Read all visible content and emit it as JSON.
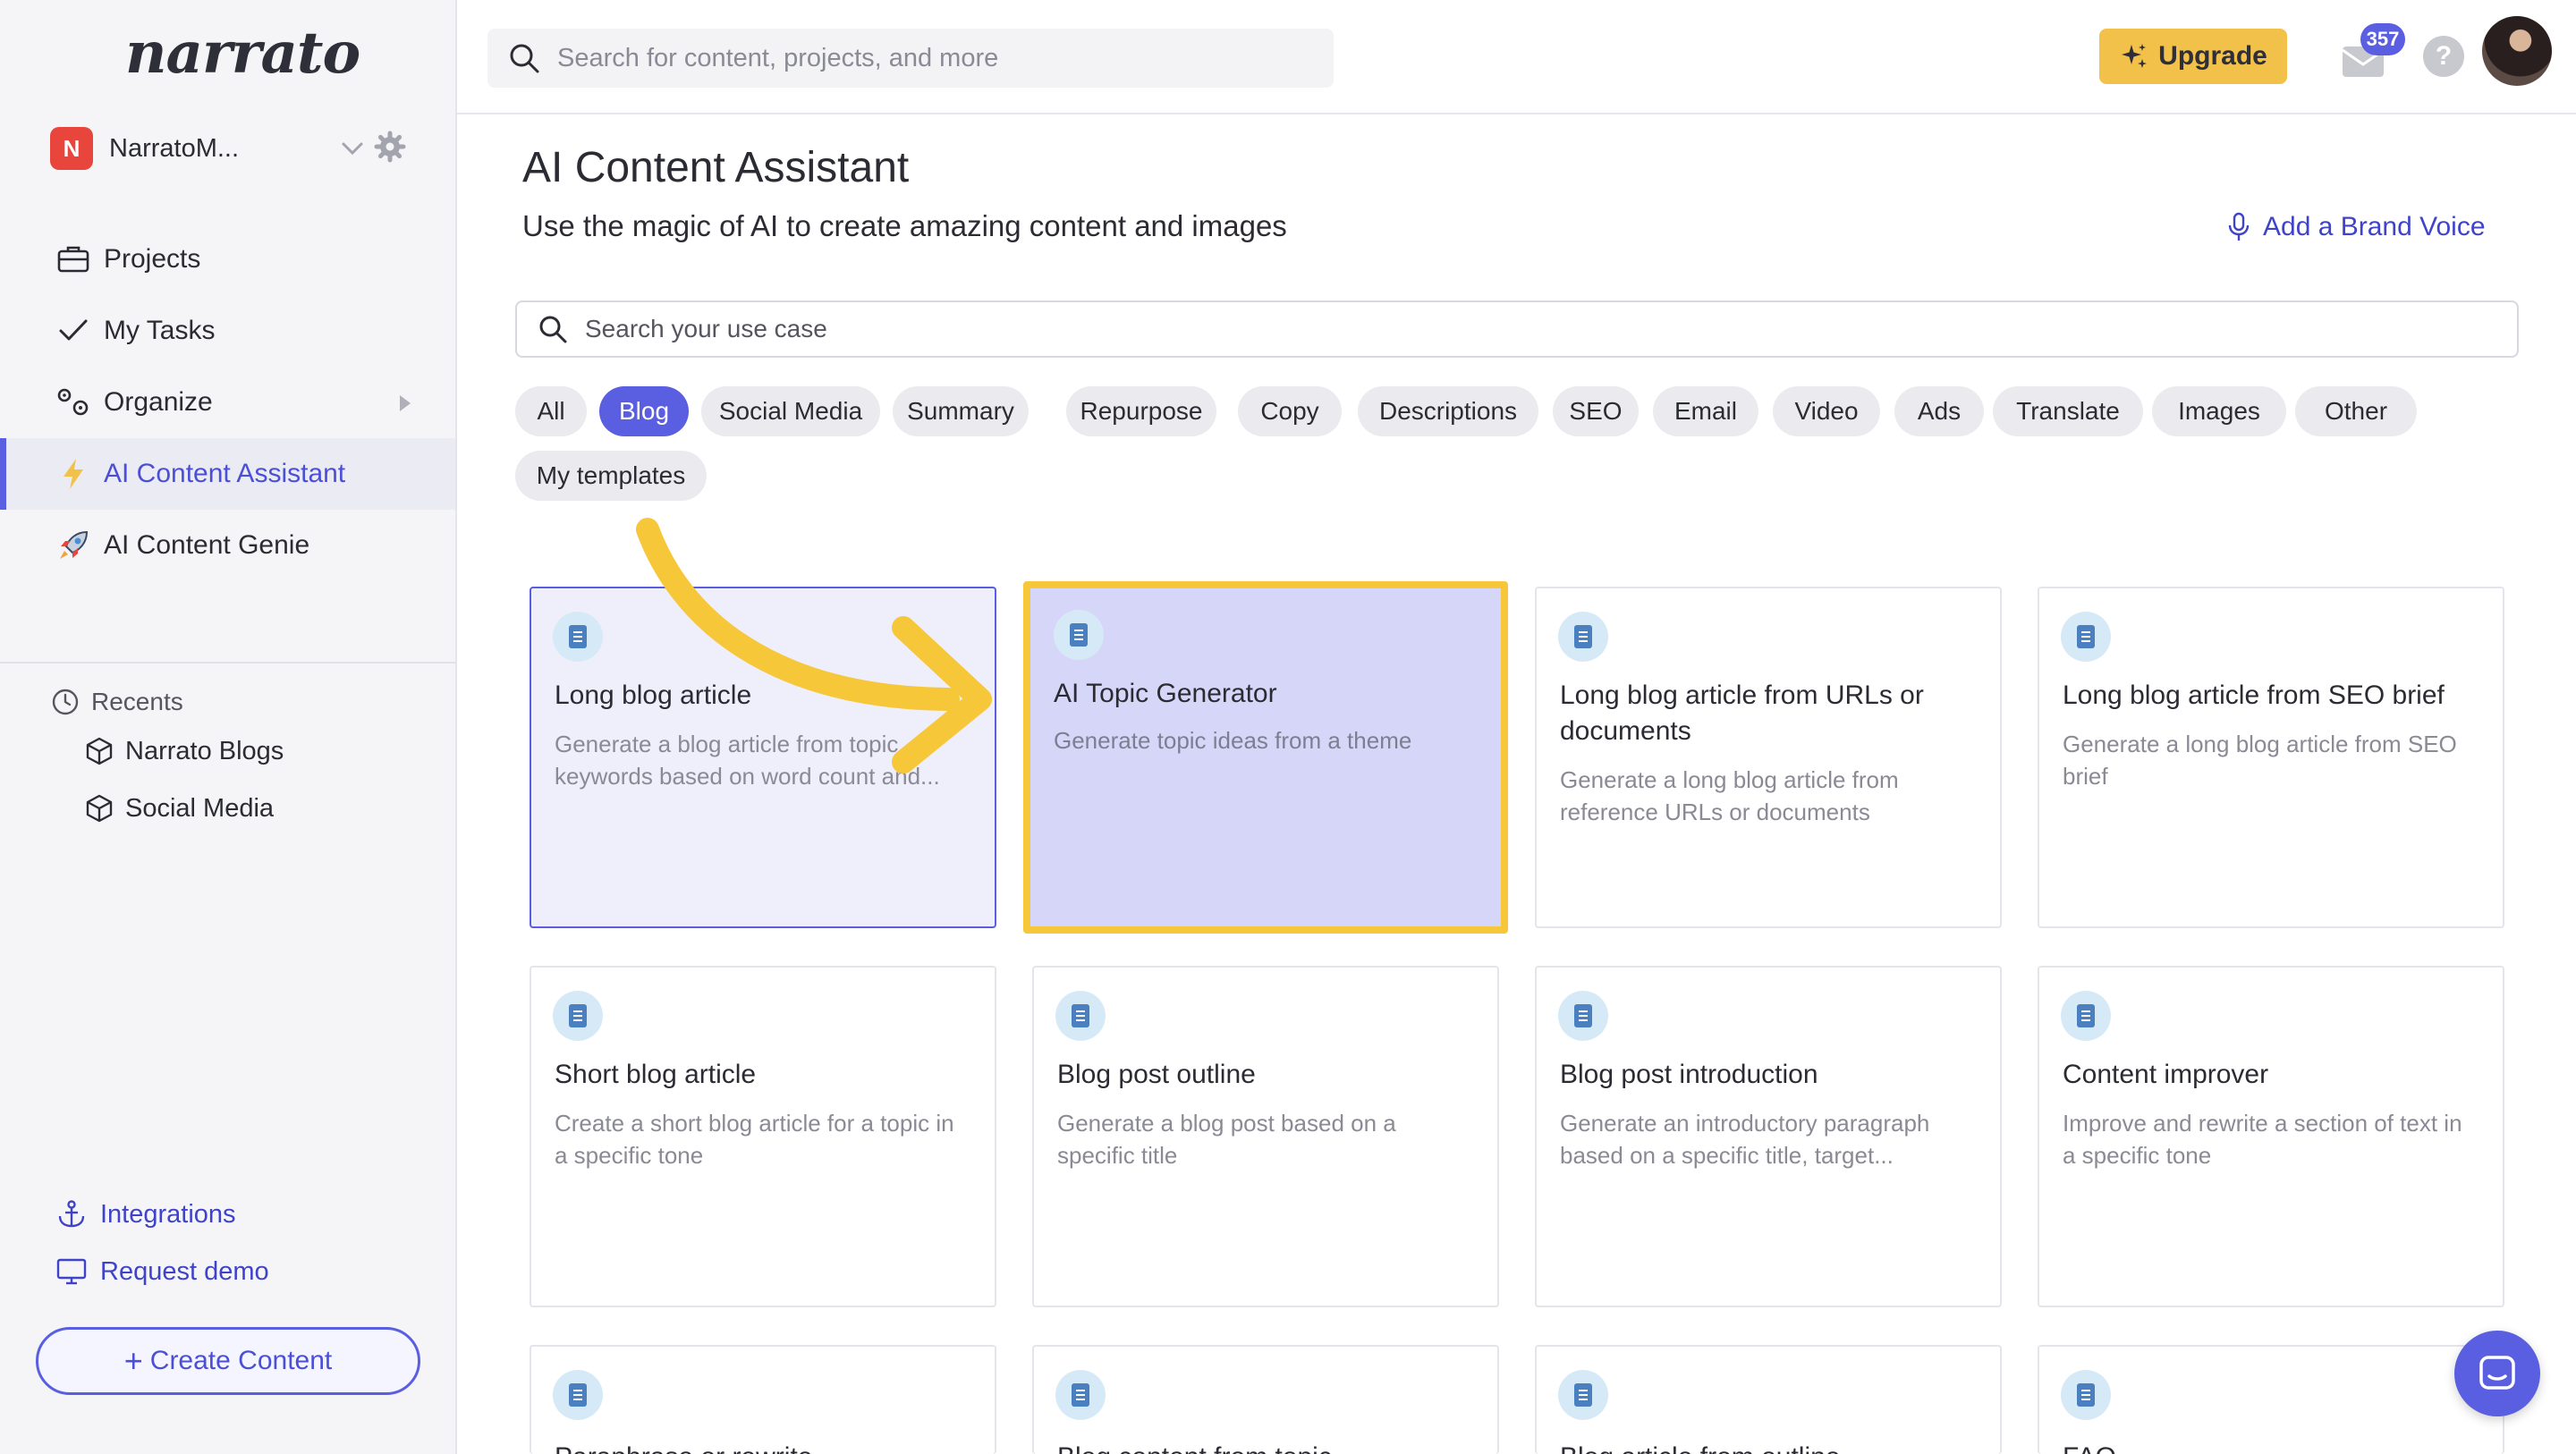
{
  "app": {
    "logo_text": "narrato"
  },
  "workspace": {
    "initial": "N",
    "name": "NarratoM..."
  },
  "sidebar": {
    "items": [
      {
        "label": "Projects",
        "icon": "briefcase-icon"
      },
      {
        "label": "My Tasks",
        "icon": "checkmark-icon"
      },
      {
        "label": "Organize",
        "icon": "organize-icon"
      },
      {
        "label": "AI Content Assistant",
        "icon": "lightning-icon",
        "active": true
      },
      {
        "label": "AI Content Genie",
        "icon": "rocket-icon"
      }
    ],
    "recents_title": "Recents",
    "recents": [
      {
        "label": "Narrato Blogs",
        "icon": "cube-icon"
      },
      {
        "label": "Social Media",
        "icon": "cube-icon"
      }
    ],
    "integrations_label": "Integrations",
    "request_demo_label": "Request demo",
    "create_content_label": "Create Content"
  },
  "topbar": {
    "search_placeholder": "Search for content, projects, and more",
    "upgrade_label": "Upgrade",
    "mail_count": "357",
    "help_label": "?"
  },
  "main": {
    "title": "AI Content Assistant",
    "subtitle": "Use the magic of AI to create amazing content and images",
    "brand_voice_label": "Add a Brand Voice",
    "usecase_search_placeholder": "Search your use case",
    "chips": [
      "All",
      "Blog",
      "Social Media",
      "Summary",
      "Repurpose",
      "Copy",
      "Descriptions",
      "SEO",
      "Email",
      "Video",
      "Ads",
      "Translate",
      "Images",
      "Other",
      "My templates"
    ],
    "active_chip": "Blog",
    "cards": [
      {
        "title": "Long blog article",
        "desc": "Generate a blog article from topic, keywords based on word count and..."
      },
      {
        "title": "AI Topic Generator",
        "desc": "Generate topic ideas from a theme"
      },
      {
        "title": "Long blog article from URLs or documents",
        "desc": "Generate a long blog article from reference URLs or documents"
      },
      {
        "title": "Long blog article from SEO brief",
        "desc": "Generate a long blog article from SEO brief"
      },
      {
        "title": "Short blog article",
        "desc": "Create a short blog article for a topic in a specific tone"
      },
      {
        "title": "Blog post outline",
        "desc": "Generate a blog post based on a specific title"
      },
      {
        "title": "Blog post introduction",
        "desc": "Generate an introductory paragraph based on a specific title, target..."
      },
      {
        "title": "Content improver",
        "desc": "Improve and rewrite a section of text in a specific tone"
      },
      {
        "title": "Paraphrase or rewrite",
        "desc": ""
      },
      {
        "title": "Blog content from topic",
        "desc": ""
      },
      {
        "title": "Blog article from outline",
        "desc": ""
      },
      {
        "title": "FAQ",
        "desc": ""
      }
    ]
  },
  "colors": {
    "accent": "#5a5ee0",
    "upgrade": "#f2c14a",
    "highlight_border": "#f7c73a",
    "workspace_badge": "#e8453c"
  }
}
